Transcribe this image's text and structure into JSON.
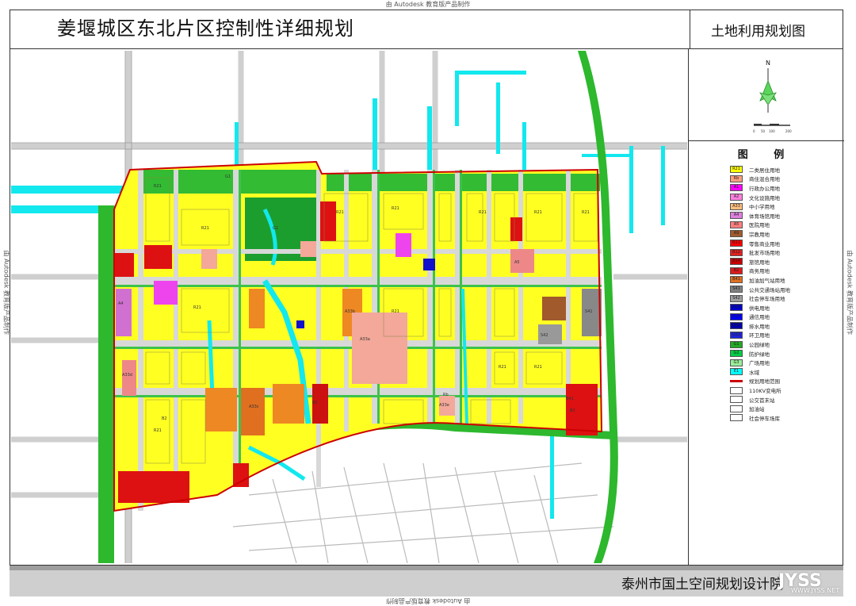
{
  "watermarks": {
    "top": "由 Autodesk 教育版产品制作",
    "bottom": "由 Autodesk 教育版产品制作",
    "left": "由 Autodesk 教育版产品制作",
    "right": "由 Autodesk 教育版产品制作"
  },
  "header": {
    "title": "姜堰城区东北片区控制性详细规划",
    "subtitle": "土地利用规划图"
  },
  "compass": {
    "north_label": "N",
    "scale_ticks": [
      "0",
      "50",
      "100",
      "200"
    ]
  },
  "legend": {
    "title": "图 例",
    "items": [
      {
        "code": "R21",
        "label": "二类居住用地",
        "color": "#ffff00"
      },
      {
        "code": "Rb",
        "label": "商住混合用地",
        "color": "#ff9f7f"
      },
      {
        "code": "A1",
        "label": "行政办公用地",
        "color": "#ff00ff"
      },
      {
        "code": "A2",
        "label": "文化设施用地",
        "color": "#ff7fdf"
      },
      {
        "code": "A33",
        "label": "中小学用地",
        "color": "#ffbf7f"
      },
      {
        "code": "A4",
        "label": "体育场馆用地",
        "color": "#df7fdf"
      },
      {
        "code": "A5",
        "label": "医院用地",
        "color": "#ff7f7f"
      },
      {
        "code": "A9",
        "label": "宗教用地",
        "color": "#a05a2c"
      },
      {
        "code": "B11",
        "label": "零售商业用地",
        "color": "#ff0000"
      },
      {
        "code": "B12",
        "label": "批发市场用地",
        "color": "#e02020"
      },
      {
        "code": "B14",
        "label": "旅馆用地",
        "color": "#cc0000"
      },
      {
        "code": "B2",
        "label": "商务用地",
        "color": "#dd1a1a"
      },
      {
        "code": "B41",
        "label": "加油加气站用地",
        "color": "#e07020"
      },
      {
        "code": "S41",
        "label": "公共交通场站用地",
        "color": "#808080"
      },
      {
        "code": "S42",
        "label": "社会停车场用地",
        "color": "#a0a0a0"
      },
      {
        "code": "U12",
        "label": "供电用地",
        "color": "#0000cc"
      },
      {
        "code": "U15",
        "label": "通信用地",
        "color": "#0000ff"
      },
      {
        "code": "U21",
        "label": "排水用地",
        "color": "#0000aa"
      },
      {
        "code": "U22",
        "label": "环卫用地",
        "color": "#2222dd"
      },
      {
        "code": "G1",
        "label": "公园绿地",
        "color": "#22aa22"
      },
      {
        "code": "G2",
        "label": "防护绿地",
        "color": "#00cc44"
      },
      {
        "code": "G3",
        "label": "广场用地",
        "color": "#99ee99"
      },
      {
        "code": "E1",
        "label": "水域",
        "color": "#00ffff"
      },
      {
        "code": "",
        "label": "规划用地范围",
        "color": "#cc0000",
        "type": "line"
      },
      {
        "code": "",
        "label": "110KV变电所",
        "color": "#ffffff"
      },
      {
        "code": "",
        "label": "公交首末站",
        "color": "#ffffff"
      },
      {
        "code": "",
        "label": "加油站",
        "color": "#ffffff"
      },
      {
        "code": "",
        "label": "社会停车场库",
        "color": "#ffffff"
      }
    ]
  },
  "footer": {
    "institute": "泰州市国土空间规划设计院",
    "site_mark": "JYSS",
    "site_url": "WWW.JYSS.NET"
  },
  "colors": {
    "residential": "#ffff00",
    "commercial": "#e00000",
    "green": "#2db82d",
    "park": "#1faa3a",
    "water": "#12e8ee",
    "school": "#ee8822",
    "medical": "#f3a89a",
    "road": "#d8d8d8",
    "boundary": "#cc0000"
  },
  "map": {
    "block_labels": [
      "R21",
      "R21",
      "R21",
      "R21",
      "R21",
      "R21",
      "R21",
      "R21",
      "R21",
      "R21",
      "R21",
      "R21",
      "B2",
      "B2",
      "B2",
      "G1",
      "G1",
      "A33b",
      "A33a",
      "A33c",
      "A33d",
      "A33e",
      "A4",
      "A5",
      "S41",
      "S42",
      "B41",
      "Rb"
    ]
  }
}
